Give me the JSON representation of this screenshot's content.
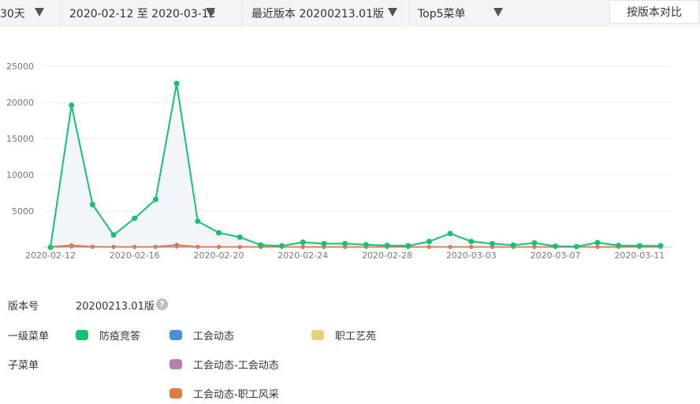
{
  "toolbar": {
    "range_label": "30天",
    "date_range": "2020-02-12 至 2020-03-12",
    "version_label": "最近版本 20200213.01版",
    "menu_filter": "Top5菜单",
    "compare_button": "按版本对比"
  },
  "info": {
    "version_label": "版本号",
    "version_value": "20200213.01版",
    "help_icon": "question-circle-icon",
    "level1_label": "一级菜单",
    "submenu_label": "子菜单"
  },
  "legend": {
    "level1": [
      {
        "name": "防疫竞答",
        "color": "#16c172"
      },
      {
        "name": "工会动态",
        "color": "#4a90d9"
      },
      {
        "name": "职工艺苑",
        "color": "#e9cf7c"
      }
    ],
    "submenu": [
      {
        "name": "工会动态-工会动态",
        "color": "#b97db0"
      },
      {
        "name": "工会动态-职工风采",
        "color": "#e07a3f"
      }
    ]
  },
  "chart_data": {
    "type": "line",
    "x": [
      "2020-02-12",
      "2020-02-13",
      "2020-02-14",
      "2020-02-15",
      "2020-02-16",
      "2020-02-17",
      "2020-02-18",
      "2020-02-19",
      "2020-02-20",
      "2020-02-21",
      "2020-02-22",
      "2020-02-23",
      "2020-02-24",
      "2020-02-25",
      "2020-02-26",
      "2020-02-27",
      "2020-02-28",
      "2020-02-29",
      "2020-03-01",
      "2020-03-02",
      "2020-03-03",
      "2020-03-04",
      "2020-03-05",
      "2020-03-06",
      "2020-03-07",
      "2020-03-08",
      "2020-03-09",
      "2020-03-10",
      "2020-03-11",
      "2020-03-12"
    ],
    "xtick_labels": [
      "2020-02-12",
      "2020-02-16",
      "2020-02-20",
      "2020-02-24",
      "2020-02-28",
      "2020-03-03",
      "2020-03-07",
      "2020-03-11"
    ],
    "xtick_indices": [
      0,
      4,
      8,
      12,
      16,
      20,
      24,
      28
    ],
    "yticks": [
      5000,
      10000,
      15000,
      20000,
      25000
    ],
    "ylim": [
      0,
      25000
    ],
    "grid": true,
    "series": [
      {
        "name": "防疫竞答",
        "color": "#16c172",
        "values": [
          0,
          19600,
          5900,
          1700,
          4000,
          6600,
          22600,
          3600,
          2000,
          1400,
          300,
          200,
          700,
          500,
          500,
          350,
          250,
          200,
          800,
          1900,
          800,
          500,
          300,
          600,
          150,
          100,
          650,
          250,
          200,
          200
        ]
      },
      {
        "name": "工会动态",
        "color": "#4a90d9",
        "values": [
          50,
          90,
          60,
          40,
          40,
          50,
          90,
          50,
          40,
          40,
          40,
          40,
          40,
          40,
          40,
          40,
          40,
          40,
          40,
          40,
          40,
          40,
          40,
          40,
          40,
          40,
          40,
          40,
          40,
          40
        ]
      },
      {
        "name": "职工艺苑",
        "color": "#e9cf7c",
        "values": [
          80,
          150,
          110,
          80,
          80,
          90,
          160,
          90,
          80,
          70,
          70,
          70,
          70,
          70,
          70,
          70,
          70,
          70,
          70,
          70,
          70,
          70,
          70,
          70,
          70,
          70,
          70,
          70,
          70,
          70
        ]
      },
      {
        "name": "工会动态-工会动态",
        "color": "#b97db0",
        "values": [
          40,
          80,
          50,
          30,
          30,
          40,
          80,
          40,
          30,
          30,
          30,
          30,
          30,
          30,
          30,
          30,
          30,
          30,
          30,
          30,
          30,
          30,
          30,
          30,
          30,
          30,
          30,
          30,
          30,
          30
        ]
      },
      {
        "name": "工会动态-职工风采",
        "color": "#e07a3f",
        "values": [
          60,
          300,
          100,
          60,
          60,
          80,
          350,
          70,
          60,
          50,
          50,
          50,
          50,
          50,
          50,
          50,
          50,
          50,
          50,
          50,
          50,
          50,
          50,
          50,
          50,
          50,
          50,
          50,
          50,
          50
        ]
      }
    ]
  }
}
